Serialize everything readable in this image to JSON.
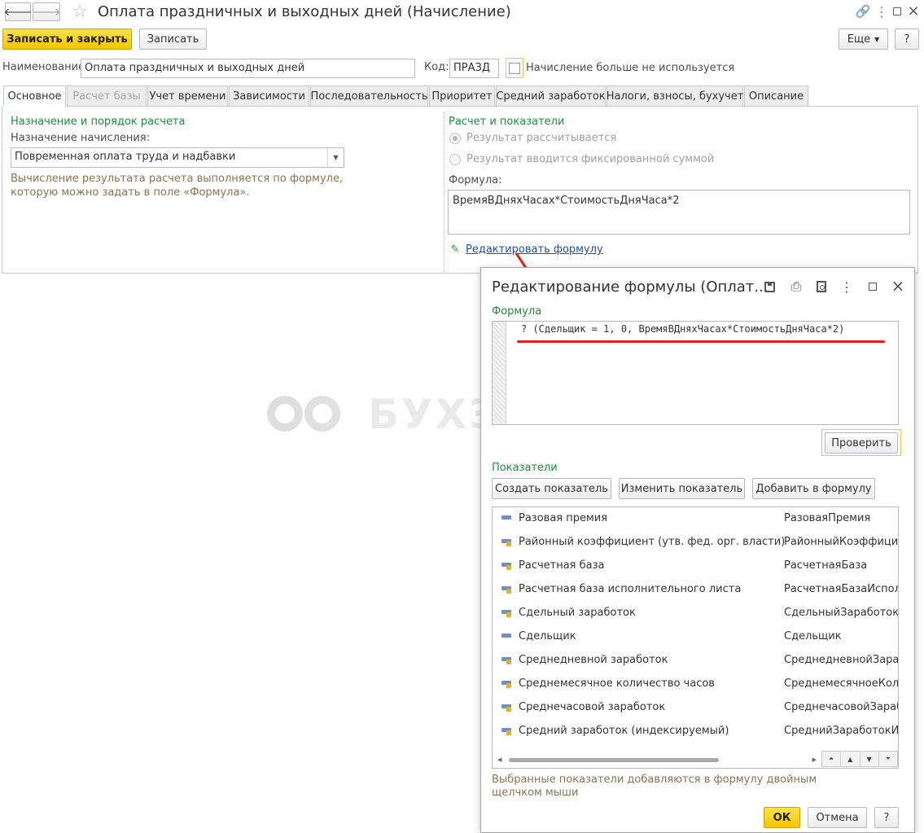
{
  "window": {
    "title": "Оплата праздничных и выходных дней (Начисление)"
  },
  "toolbar": {
    "save_close": "Записать и закрыть",
    "save": "Записать",
    "more": "Еще",
    "help": "?"
  },
  "header_fields": {
    "name_label": "Наименование:",
    "name_value": "Оплата праздничных и выходных дней",
    "code_label": "Код:",
    "code_value": "ПРАЗД",
    "unused_label": "Начисление больше не используется"
  },
  "tabs": [
    {
      "label": "Основное",
      "active": true
    },
    {
      "label": "Расчет базы",
      "disabled": true
    },
    {
      "label": "Учет времени"
    },
    {
      "label": "Зависимости"
    },
    {
      "label": "Последовательность"
    },
    {
      "label": "Приоритет"
    },
    {
      "label": "Средний заработок"
    },
    {
      "label": "Налоги, взносы, бухучет"
    },
    {
      "label": "Описание"
    }
  ],
  "left_panel": {
    "section_title": "Назначение и порядок расчета",
    "purpose_label": "Назначение начисления:",
    "purpose_value": "Повременная оплата труда и надбавки",
    "hint_line1": "Вычисление результата расчета выполняется по формуле,",
    "hint_line2": "которую можно задать в поле «Формула»."
  },
  "right_panel": {
    "section_title": "Расчет и показатели",
    "radio_calculated": "Результат рассчитывается",
    "radio_fixed": "Результат вводится фиксированной суммой",
    "formula_label": "Формула:",
    "formula_value": "ВремяВДняхЧасах*СтоимостьДняЧаса*2",
    "edit_link": "Редактировать формулу"
  },
  "watermark": "БУХЭКСПЕРТ",
  "dialog": {
    "title": "Редактирование формулы (Оплат...",
    "formula_section": "Формула",
    "formula_text": "? (Сдельщик = 1, 0, ВремяВДняхЧасах*СтоимостьДняЧаса*2)",
    "check_button": "Проверить",
    "indicators_section": "Показатели",
    "create_button": "Создать показатель",
    "change_button": "Изменить показатель",
    "add_button": "Добавить в формулу",
    "indicators": [
      {
        "name": "Разовая премия",
        "id": "РазоваяПремия",
        "icon": "plain"
      },
      {
        "name": "Районный коэффициент (утв. фед. орг. власти)",
        "id": "РайонныйКоэффициент",
        "icon": "pencil"
      },
      {
        "name": "Расчетная база",
        "id": "РасчетнаяБаза",
        "icon": "pencil"
      },
      {
        "name": "Расчетная база исполнительного листа",
        "id": "РасчетнаяБазаИсполни",
        "icon": "pencil"
      },
      {
        "name": "Сдельный заработок",
        "id": "СдельныйЗаработок",
        "icon": "pencil"
      },
      {
        "name": "Сдельщик",
        "id": "Сдельщик",
        "icon": "plain"
      },
      {
        "name": "Среднедневной заработок",
        "id": "СреднедневнойЗаработ",
        "icon": "pencil"
      },
      {
        "name": "Среднемесячное количество часов",
        "id": "СреднемесячноеКолич",
        "icon": "pencil"
      },
      {
        "name": "Среднечасовой заработок",
        "id": "СреднечасовойЗаработ",
        "icon": "pencil"
      },
      {
        "name": "Средний заработок (индексируемый)",
        "id": "СреднийЗаработокИнде",
        "icon": "pencil"
      }
    ],
    "footer_hint_line1": "Выбранные показатели добавляются в формулу двойным",
    "footer_hint_line2": "щелчком мыши",
    "ok": "ОК",
    "cancel": "Отмена",
    "help": "?"
  },
  "colors": {
    "accent_yellow": "#f5c400",
    "section_green": "#1a8f3a",
    "link_blue": "#1f4fa8",
    "annotation_red": "#e02020"
  }
}
